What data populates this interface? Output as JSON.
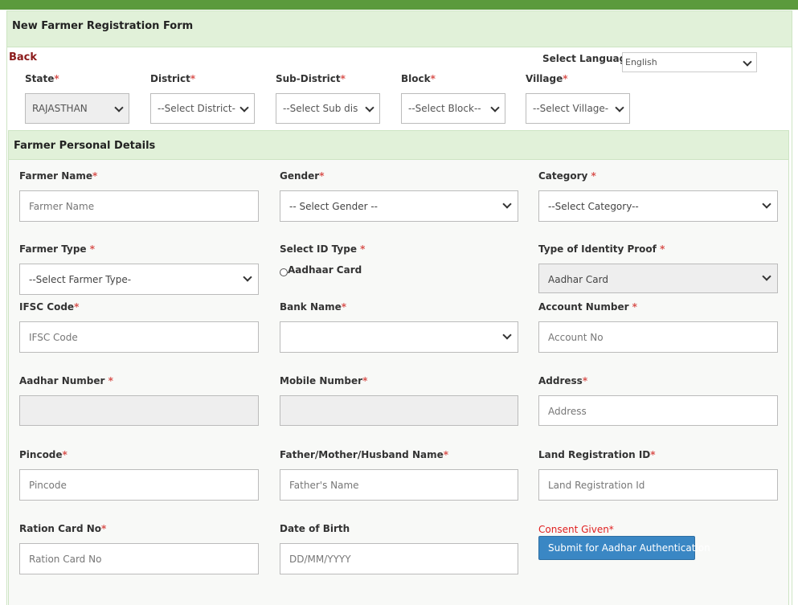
{
  "form": {
    "title": "New Farmer Registration Form",
    "back_label": "Back",
    "language_label": "Select Language",
    "language_value": "English"
  },
  "location": {
    "state": {
      "label": "State",
      "req": "*",
      "value": "RAJASTHAN"
    },
    "district": {
      "label": "District",
      "req": "*",
      "value": "--Select District-"
    },
    "subdistrict": {
      "label": "Sub-District",
      "req": "*",
      "value": "--Select Sub dis"
    },
    "block": {
      "label": "Block",
      "req": "*",
      "value": "--Select Block--"
    },
    "village": {
      "label": "Village",
      "req": "*",
      "value": "--Select Village-"
    }
  },
  "personal": {
    "title": "Farmer Personal Details",
    "farmer_name": {
      "label": "Farmer Name",
      "req": "*",
      "placeholder": "Farmer Name"
    },
    "gender": {
      "label": "Gender",
      "req": "*",
      "value": "-- Select Gender --"
    },
    "category": {
      "label": "Category",
      "req": " *",
      "value": "--Select Category--"
    },
    "farmer_type": {
      "label": "Farmer Type",
      "req": " *",
      "value": "--Select Farmer Type-"
    },
    "id_type": {
      "label": "Select ID Type",
      "req": " *",
      "option": "Aadhaar Card"
    },
    "identity_proof": {
      "label": "Type of Identity Proof",
      "req": " *",
      "value": "Aadhar Card"
    },
    "ifsc": {
      "label": "IFSC Code",
      "req": "*",
      "placeholder": "IFSC Code"
    },
    "bank": {
      "label": "Bank Name",
      "req": "*",
      "value": ""
    },
    "account": {
      "label": "Account Number",
      "req": " *",
      "placeholder": "Account No"
    },
    "aadhar": {
      "label": "Aadhar Number",
      "req": " *",
      "value": ""
    },
    "mobile": {
      "label": "Mobile Number",
      "req": "*",
      "value": ""
    },
    "address": {
      "label": "Address",
      "req": "*",
      "placeholder": "Address"
    },
    "pincode": {
      "label": "Pincode",
      "req": "*",
      "placeholder": "Pincode"
    },
    "parent": {
      "label": "Father/Mother/Husband Name",
      "req": "*",
      "placeholder": "Father's Name"
    },
    "land": {
      "label": "Land Registration ID",
      "req": "*",
      "placeholder": "Land Registration Id"
    },
    "ration": {
      "label": "Ration Card No",
      "req": "*",
      "placeholder": "Ration Card No"
    },
    "dob": {
      "label": "Date of Birth",
      "placeholder": "DD/MM/YYYY"
    },
    "consent_label": "Consent Given*",
    "submit_label": "Submit for Aadhar Authentication"
  }
}
